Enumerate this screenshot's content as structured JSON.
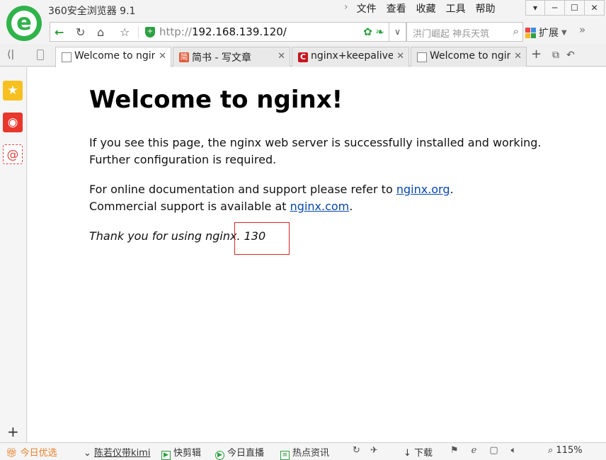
{
  "window": {
    "title": "360安全浏览器 9.1",
    "menu": [
      "文件",
      "查看",
      "收藏",
      "工具",
      "帮助"
    ],
    "logo_letter": "e"
  },
  "navbar": {
    "url_protocol": "http://",
    "url_host": "192.168.139.120/",
    "search_placeholder": "洪门崛起 神兵天筑",
    "extensions_label": "扩展",
    "more_glyph": "»"
  },
  "tabs": [
    {
      "label": "Welcome to nginx!",
      "icon": "doc-icon",
      "active": true
    },
    {
      "label": "简书 - 写文章",
      "icon": "jianshu-icon",
      "icon_char": "简",
      "active": false
    },
    {
      "label": "nginx+keepalived",
      "icon": "csdn-icon",
      "icon_char": "C",
      "active": false
    },
    {
      "label": "Welcome to nginx!",
      "icon": "doc-icon",
      "active": false
    }
  ],
  "page": {
    "heading": "Welcome to nginx!",
    "p1_line1": "If you see this page, the nginx web server is successfully installed and working.",
    "p1_line2": "Further configuration is required.",
    "p2_prefix": "For online documentation and support please refer to ",
    "p2_link": "nginx.org",
    "p2_suffix": ".",
    "p3_prefix": "Commercial support is available at ",
    "p3_link": "nginx.com",
    "p3_suffix": ".",
    "thanks": "Thank you for using nginx. 130"
  },
  "statusbar": {
    "deals": "今日优选",
    "news": "陈若仪带kimi",
    "clip": "快剪辑",
    "live": "今日直播",
    "hot": "热点资讯",
    "download": "下载",
    "zoom": "115%"
  },
  "colors": {
    "brand_green": "#2fb34a",
    "link_blue": "#0645ad",
    "highlight_red": "#d22222"
  }
}
